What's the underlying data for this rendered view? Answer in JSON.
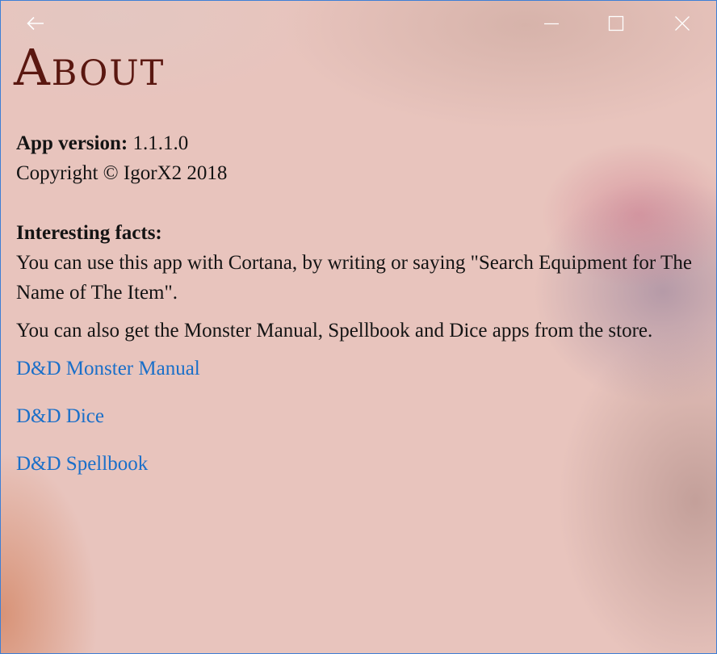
{
  "titlebar": {
    "back_icon": "arrow-left-icon",
    "minimize_icon": "minimize-icon",
    "maximize_icon": "maximize-icon",
    "close_icon": "close-icon"
  },
  "page": {
    "title": "About"
  },
  "info": {
    "version_label": "App version:",
    "version_value": "1.1.1.0",
    "copyright": "Copyright © IgorX2 2018"
  },
  "facts": {
    "heading": "Interesting facts:",
    "paragraphs": [
      "You can use this app with Cortana, by writing or saying \"Search Equipment for The Name of The Item\".",
      "You can also get the Monster Manual, Spellbook and Dice apps from the store."
    ]
  },
  "links": [
    {
      "label": "D&D Monster Manual"
    },
    {
      "label": "D&D Dice"
    },
    {
      "label": "D&D Spellbook"
    }
  ],
  "colors": {
    "title": "#5a1710",
    "link": "#1a6fc9",
    "text": "#141414",
    "window_border": "#3d7fd6"
  }
}
